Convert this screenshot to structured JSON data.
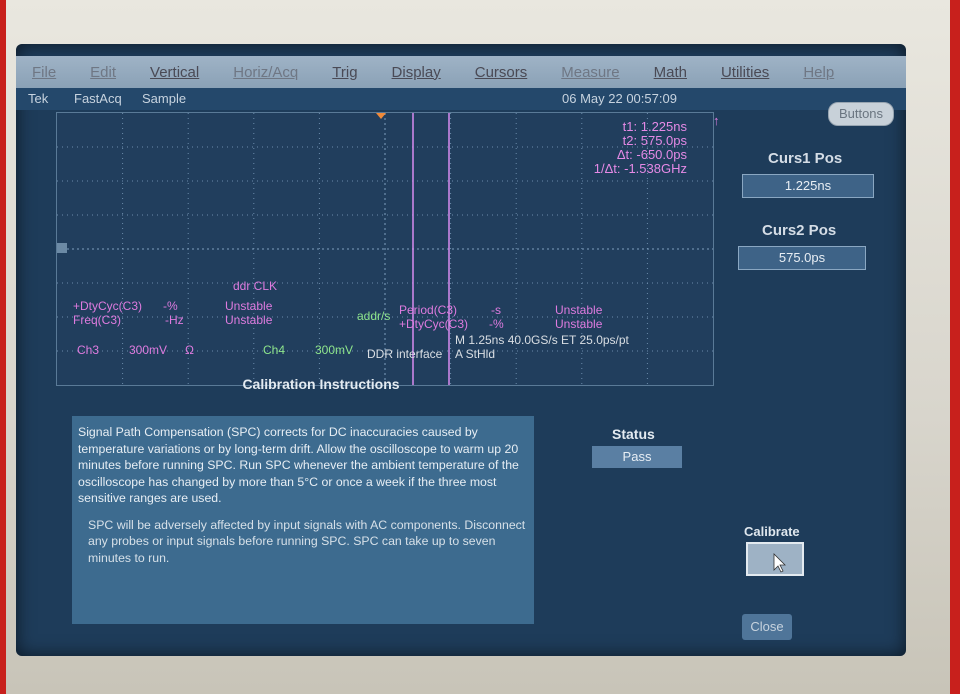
{
  "menu": {
    "items": [
      {
        "label": "File",
        "dim": true
      },
      {
        "label": "Edit",
        "dim": true
      },
      {
        "label": "Vertical",
        "dim": false
      },
      {
        "label": "Horiz/Acq",
        "dim": true
      },
      {
        "label": "Trig",
        "dim": false
      },
      {
        "label": "Display",
        "dim": false
      },
      {
        "label": "Cursors",
        "dim": false
      },
      {
        "label": "Measure",
        "dim": true
      },
      {
        "label": "Math",
        "dim": false
      },
      {
        "label": "Utilities",
        "dim": false
      },
      {
        "label": "Help",
        "dim": true
      }
    ]
  },
  "status": {
    "brand": "Tek",
    "acq_mode": "FastAcq",
    "sample": "Sample",
    "datetime": "06 May 22 00:57:09",
    "buttons_label": "Buttons"
  },
  "cursors": {
    "t1": "t1:  1.225ns",
    "t2": "t2:  575.0ps",
    "dt": "Δt: -650.0ps",
    "inv_dt": "1/Δt: -1.538GHz"
  },
  "measurements": {
    "ddr_clk": "ddr CLK",
    "dutycyc_c3": "+DtyCyc(C3)",
    "dutycyc_c3_val": "-%",
    "dutycyc_c3_state": "Unstable",
    "freq_c3": "Freq(C3)",
    "freq_c3_val": "-Hz",
    "freq_c3_state": "Unstable",
    "addr": "addr/s",
    "period_c3": "Period(C3)",
    "period_c3_val": "-s",
    "period_c3_state": "Unstable",
    "dutycyc2": "+DtyCyc(C3)",
    "dutycyc2_val": "-%",
    "dutycyc2_state": "Unstable",
    "timebase": "M 1.25ns 40.0GS/s ET 25.0ps/pt",
    "ch3": "Ch3",
    "ch3_scale": "300mV",
    "ch3_sym": "Ω",
    "ch4": "Ch4",
    "ch4_scale": "300mV",
    "ddr_interface": "DDR interface",
    "trig": "A  StHld"
  },
  "right_panel": {
    "curs1_label": "Curs1 Pos",
    "curs1_value": "1.225ns",
    "curs2_label": "Curs2 Pos",
    "curs2_value": "575.0ps"
  },
  "calibration": {
    "title": "Calibration Instructions",
    "para1": "Signal Path Compensation (SPC) corrects for DC inaccuracies caused by temperature variations or by long-term drift.  Allow the oscilloscope to warm up 20 minutes before running SPC.  Run SPC whenever the ambient temperature of the oscilloscope  has changed by more than 5°C or once a week if the three  most sensitive ranges are used.",
    "para2": "SPC will be adversely affected by input signals with AC components.  Disconnect any probes or input signals before running SPC.  SPC can take up to seven minutes to run.",
    "status_label": "Status",
    "status_value": "Pass",
    "calibrate_label": "Calibrate",
    "close_label": "Close"
  },
  "colors": {
    "screen_bg": "#1e3c5a",
    "cursor_magenta": "#de7bdf",
    "channel_green": "#8ee58c",
    "bezel_red": "#c8201c"
  }
}
